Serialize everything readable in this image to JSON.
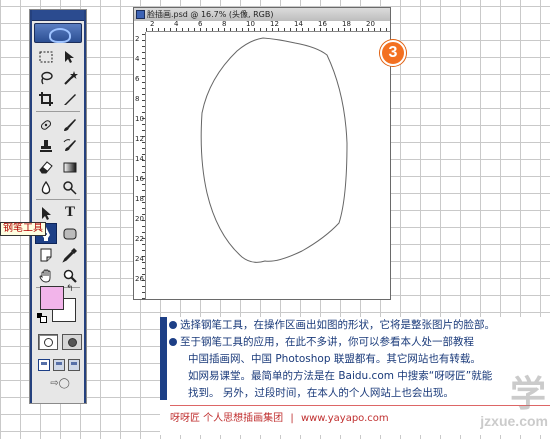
{
  "document": {
    "title": "脸插画.psd @ 16.7% (头像, RGB)",
    "ruler_top_marks": [
      "2",
      "4",
      "6",
      "8",
      "10",
      "12",
      "14",
      "16",
      "18",
      "20"
    ],
    "ruler_left_marks": [
      "2",
      "4",
      "6",
      "8",
      "10",
      "12",
      "14",
      "16",
      "18",
      "20",
      "22",
      "24",
      "26"
    ]
  },
  "toolbox": {
    "tooltip": "钢笔工具",
    "foreground_color": "#f2b4ea",
    "background_color": "#ffffff",
    "active_tool": "pen-icon",
    "tools": [
      [
        "marquee-icon",
        "move-icon"
      ],
      [
        "lasso-icon",
        "magic-wand-icon"
      ],
      [
        "crop-icon",
        "slice-icon"
      ],
      [
        "healing-brush-icon",
        "brush-icon"
      ],
      [
        "clone-stamp-icon",
        "history-brush-icon"
      ],
      [
        "eraser-icon",
        "gradient-icon"
      ],
      [
        "blur-icon",
        "dodge-icon"
      ],
      [
        "path-selection-icon",
        "type-icon"
      ],
      [
        "pen-icon",
        "shape-icon"
      ],
      [
        "notes-icon",
        "eyedropper-icon"
      ],
      [
        "hand-icon",
        "zoom-icon"
      ]
    ]
  },
  "step_badge": "3",
  "caption": {
    "line1": "选择钢笔工具，在操作区画出如图的形状，它将是整张图片的脸部。",
    "line2": "至于钢笔工具的应用，在此不多讲，你可以参看本人处一部教程",
    "line3": "中国插画网、中国 Photoshop 联盟都有。其它网站也有转载。",
    "line4": "如网易课堂。最简单的方法是在 Baidu.com 中搜索“呀呀匠”就能",
    "line5": "找到。    另外，过段时间，在本人的个人网站上也会出现。",
    "footer_author": "呀呀匠    个人思想插画集团",
    "footer_sep": "|",
    "footer_url": "www.yayapo.com"
  },
  "watermark": {
    "mark": "学",
    "url": "jzxue.com"
  }
}
